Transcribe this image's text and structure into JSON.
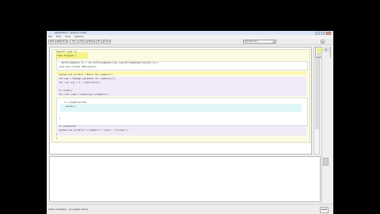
{
  "window": {
    "title": "Application - [source code]"
  },
  "menu": [
    "File",
    "Edit",
    "Tools",
    "Options"
  ],
  "toolbar": {
    "buttons": [
      "New",
      "Open/Load",
      "Cut",
      "Copy",
      "Paste",
      "Fix",
      "Unind"
    ],
    "select_value": "Selected Tool"
  },
  "editor": {
    "lines": [
      "import* java.io;",
      "class Program {",
      "{",
      "    BufferedReader br = new BufferedReader(new InputStreamReader(System.in));",
      "  void main throws IOException",
      "",
      "  System.out.println (\"Enter the numbers\");",
      "  int num = Integer.parseInt (br.readLine());",
      "  for (int sty = 1 ; styFirefoxi)",
      "",
      "  Cv count++",
      "  for (int item = substring (styNum*1));",
      "",
      "      if (itemFirst==0)",
      "       count++;",
      "",
      "  }",
      "  if (count==2)",
      "  System.out.println(\"\"+\"number\"+\" \"+sty+\" \"+\"prime\");",
      "}",
      "}"
    ]
  },
  "status": {
    "message": "Class compiled - no syntax errors",
    "right_label": "saved"
  },
  "colors": {
    "editor_region": "#fbfbe3",
    "highlight": "#f4f487",
    "lavender": "#f1eaf8",
    "cyan": "#e0f7fa"
  }
}
